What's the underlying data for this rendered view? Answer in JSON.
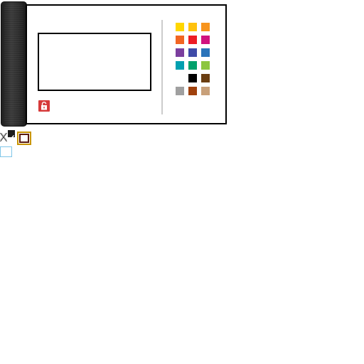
{
  "window": {
    "title": ""
  },
  "text_area": {
    "value": ""
  },
  "palette": {
    "swatches": [
      {
        "color": "#ffd700"
      },
      {
        "color": "#ffc20e"
      },
      {
        "color": "#f7941d"
      },
      {
        "color": "#f26522"
      },
      {
        "color": "#ed1c24"
      },
      {
        "color": "#d0127f"
      },
      {
        "color": "#7b3f9e"
      },
      {
        "color": "#3f4ba8"
      },
      {
        "color": "#2b74ba"
      },
      {
        "color": "#00a0b0"
      },
      {
        "color": "#00a16b"
      },
      {
        "color": "#8dc63f"
      },
      {
        "color": ""
      },
      {
        "color": "#000000"
      },
      {
        "color": "#6b3e12"
      },
      {
        "color": "#a0a0a0"
      },
      {
        "color": "#a0410d"
      },
      {
        "color": "#c8a07a"
      }
    ]
  },
  "lock_button": {
    "icon": "unlock-icon",
    "color": "#d63a3a"
  },
  "tools": {
    "cross_icon": "cross-icon",
    "check_icon": "check-icon",
    "frame_icon": "frame-icon",
    "square_icon": "square-icon"
  }
}
